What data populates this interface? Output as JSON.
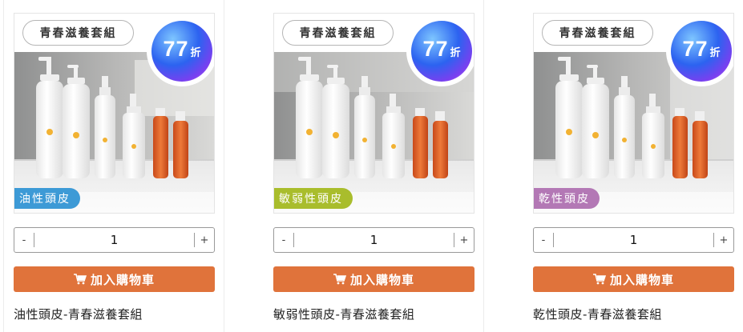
{
  "products": [
    {
      "set_label": "青春滋養套組",
      "discount_number": "77",
      "discount_unit": "折",
      "type_label": "油性頭皮",
      "type_color": "#3d9ad6",
      "quantity": "1",
      "minus_label": "-",
      "plus_label": "+",
      "add_to_cart_label": "加入購物車",
      "cart_icon": "cart-icon",
      "name": "油性頭皮-青春滋養套組"
    },
    {
      "set_label": "青春滋養套組",
      "discount_number": "77",
      "discount_unit": "折",
      "type_label": "敏弱性頭皮",
      "type_color": "#a9bd2c",
      "quantity": "1",
      "minus_label": "-",
      "plus_label": "+",
      "add_to_cart_label": "加入購物車",
      "cart_icon": "cart-icon",
      "name": "敏弱性頭皮-青春滋養套組"
    },
    {
      "set_label": "青春滋養套組",
      "discount_number": "77",
      "discount_unit": "折",
      "type_label": "乾性頭皮",
      "type_color": "#b378b5",
      "quantity": "1",
      "minus_label": "-",
      "plus_label": "+",
      "add_to_cart_label": "加入購物車",
      "cart_icon": "cart-icon",
      "name": "乾性頭皮-青春滋養套組"
    }
  ],
  "colors": {
    "accent_button": "#e0733b",
    "badge_gradient": [
      "#2c63f0",
      "#7a3ff0"
    ]
  }
}
